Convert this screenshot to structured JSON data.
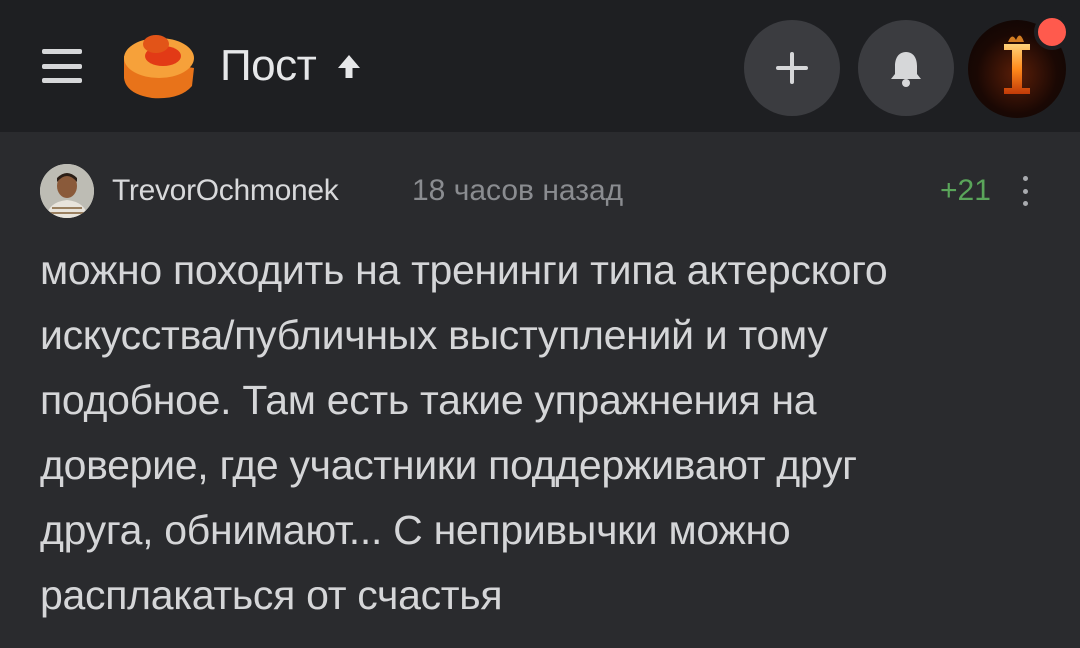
{
  "header": {
    "title": "Пост",
    "icons": [
      "menu-icon",
      "pikabu-logo",
      "arrow-up-icon",
      "plus-icon",
      "bell-icon"
    ],
    "colors": {
      "bar": "#1e1f22",
      "accent": "#ff5a4d",
      "logo": "#f08a25"
    }
  },
  "comment": {
    "username": "TrevorOchmonek",
    "time": "18 часов назад",
    "rating": "+21",
    "lines": [
      "можно походить на тренинги типа актерского",
      "искусства/публичных выступлений и тому",
      "подобное. Там есть такие упражнения на",
      "доверие, где участники поддерживают друг",
      "друга, обнимают... С непривычки можно",
      "расплакаться от счастья"
    ]
  }
}
